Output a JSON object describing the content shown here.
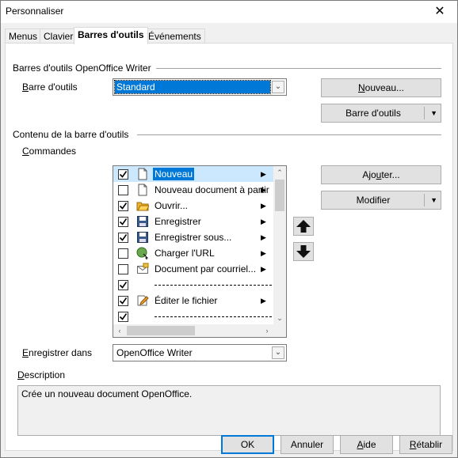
{
  "window": {
    "title": "Personnaliser",
    "close_label": "✕"
  },
  "tabs": [
    {
      "label": "Menus"
    },
    {
      "label": "Clavier"
    },
    {
      "label": "Barres d'outils"
    },
    {
      "label": "Événements"
    }
  ],
  "toolbars_section": {
    "title": "Barres d'outils OpenOffice Writer",
    "toolbar_label_pre": "",
    "toolbar_label_u": "B",
    "toolbar_label_post": "arre d'outils",
    "toolbar_value": "Standard",
    "new_button_u": "N",
    "new_button_post": "ouveau...",
    "toolbar_menu_button": "Barre d'outils"
  },
  "content_section": {
    "title": "Contenu de la barre d'outils",
    "commands_label_u": "C",
    "commands_label_post": "ommandes",
    "add_button_pre": "Ajo",
    "add_button_u": "u",
    "add_button_post": "ter...",
    "modify_button": "Modifier",
    "commands": [
      {
        "checked": true,
        "label": "Nouveau",
        "icon": "new-document-icon",
        "submenu": true,
        "separator": false,
        "selected": true
      },
      {
        "checked": false,
        "label": "Nouveau document à partir",
        "icon": "new-from-template-icon",
        "submenu": true,
        "separator": false,
        "selected": false
      },
      {
        "checked": true,
        "label": "Ouvrir...",
        "icon": "open-folder-icon",
        "submenu": true,
        "separator": false,
        "selected": false
      },
      {
        "checked": true,
        "label": "Enregistrer",
        "icon": "save-icon",
        "submenu": true,
        "separator": false,
        "selected": false
      },
      {
        "checked": true,
        "label": "Enregistrer sous...",
        "icon": "save-as-icon",
        "submenu": true,
        "separator": false,
        "selected": false
      },
      {
        "checked": false,
        "label": "Charger l'URL",
        "icon": "load-url-icon",
        "submenu": true,
        "separator": false,
        "selected": false
      },
      {
        "checked": false,
        "label": "Document par courriel...",
        "icon": "email-icon",
        "submenu": true,
        "separator": false,
        "selected": false
      },
      {
        "checked": true,
        "label": "",
        "icon": "",
        "submenu": false,
        "separator": true,
        "selected": false
      },
      {
        "checked": true,
        "label": "Éditer le fichier",
        "icon": "edit-file-icon",
        "submenu": true,
        "separator": false,
        "selected": false
      },
      {
        "checked": true,
        "label": "",
        "icon": "",
        "submenu": false,
        "separator": true,
        "selected": false
      }
    ],
    "save_in_label_u": "E",
    "save_in_label_post": "nregistrer dans",
    "save_in_value": "OpenOffice Writer",
    "description_label_u": "D",
    "description_label_post": "escription",
    "description_text": "Crée un nouveau document OpenOffice."
  },
  "footer": {
    "ok": "OK",
    "cancel": "Annuler",
    "help_u": "A",
    "help_post": "ide",
    "reset_u": "R",
    "reset_post": "établir"
  }
}
